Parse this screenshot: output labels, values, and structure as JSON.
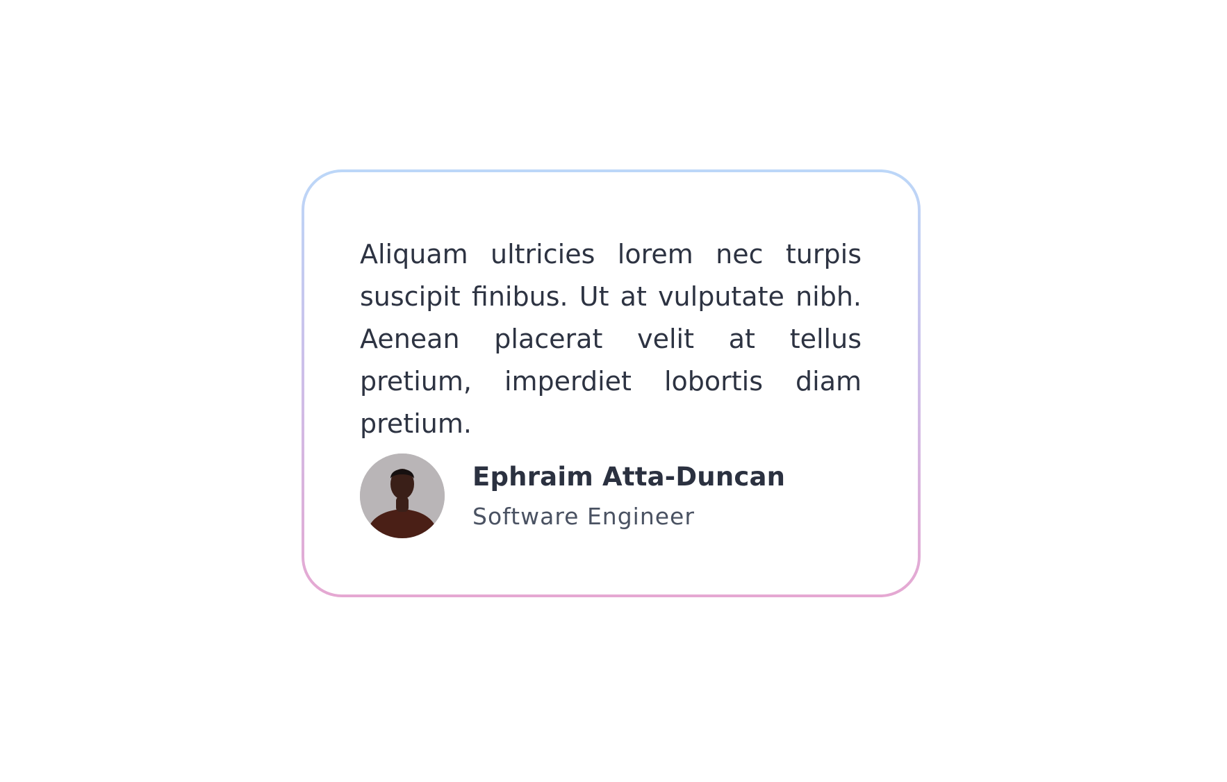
{
  "testimonial": {
    "quote": "Aliquam ultricies lorem nec turpis suscipit finibus. Ut at vulputate nibh. Aenean placerat velit at tellus pretium, imperdiet lobortis diam pretium.",
    "author": {
      "name": "Ephraim Atta-Duncan",
      "role": "Software Engineer",
      "avatar_icon": "person-portrait-icon"
    }
  },
  "colors": {
    "border_top": "#bcd7f8",
    "border_bottom": "#e5a8d2",
    "text": "#2d3342",
    "subtext": "#4a5262"
  }
}
